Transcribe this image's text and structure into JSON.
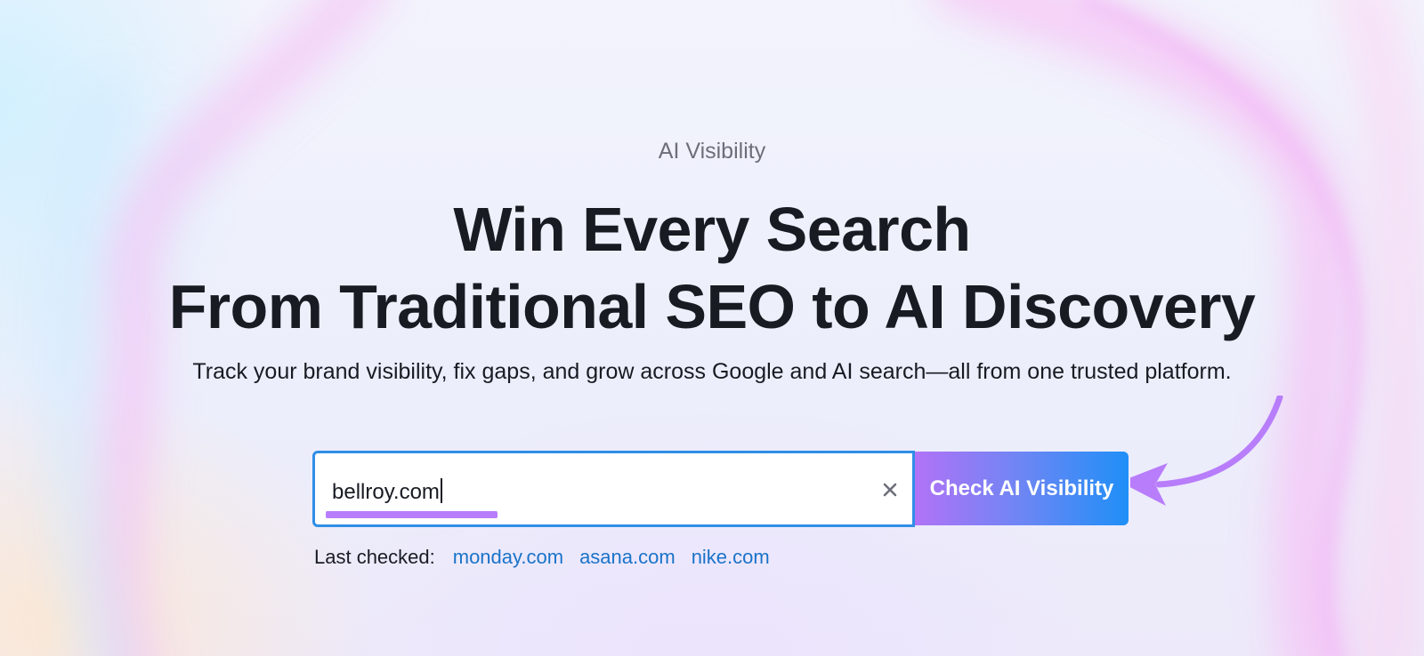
{
  "hero": {
    "eyebrow": "AI Visibility",
    "headline_line1": "Win Every Search",
    "headline_line2": "From Traditional SEO to AI Discovery",
    "subtitle": "Track your brand visibility, fix gaps, and grow across Google and AI search—all from one trusted platform."
  },
  "search": {
    "value": "bellroy.com",
    "clear_icon": "close-icon",
    "button_label": "Check AI Visibility"
  },
  "last_checked": {
    "label": "Last checked:",
    "links": [
      "monday.com",
      "asana.com",
      "nike.com"
    ]
  },
  "colors": {
    "input_border": "#2f8ee6",
    "button_gradient_start": "#b172f6",
    "button_gradient_end": "#1f8ff7",
    "link": "#1a73c8",
    "annotation": "#b87dfb"
  }
}
